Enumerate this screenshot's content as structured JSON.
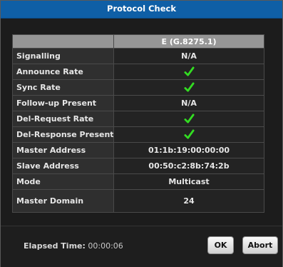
{
  "dialog": {
    "title": "Protocol Check"
  },
  "table": {
    "column_header": "E (G.8275.1)",
    "rows": [
      {
        "label": "Signalling",
        "value": "N/A",
        "pass": false
      },
      {
        "label": "Announce Rate",
        "value": "",
        "pass": true
      },
      {
        "label": "Sync Rate",
        "value": "",
        "pass": true
      },
      {
        "label": "Follow-up Present",
        "value": "N/A",
        "pass": false
      },
      {
        "label": "Del-Request Rate",
        "value": "",
        "pass": true
      },
      {
        "label": "Del-Response Present",
        "value": "",
        "pass": true
      },
      {
        "label": "Master Address",
        "value": "01:1b:19:00:00:00",
        "pass": false
      },
      {
        "label": "Slave Address",
        "value": "00:50:c2:8b:74:2b",
        "pass": false
      },
      {
        "label": "Mode",
        "value": "Multicast",
        "pass": false
      },
      {
        "label": "Master Domain",
        "value": "24",
        "pass": false
      }
    ]
  },
  "footer": {
    "elapsed_label": "Elapsed Time:",
    "elapsed_value": "00:00:06",
    "ok_label": "OK",
    "abort_label": "Abort"
  },
  "colors": {
    "title_bar": "#0f5fa6",
    "check": "#33dd22",
    "header": "#969696"
  },
  "icons": {
    "pass": "check-icon"
  }
}
